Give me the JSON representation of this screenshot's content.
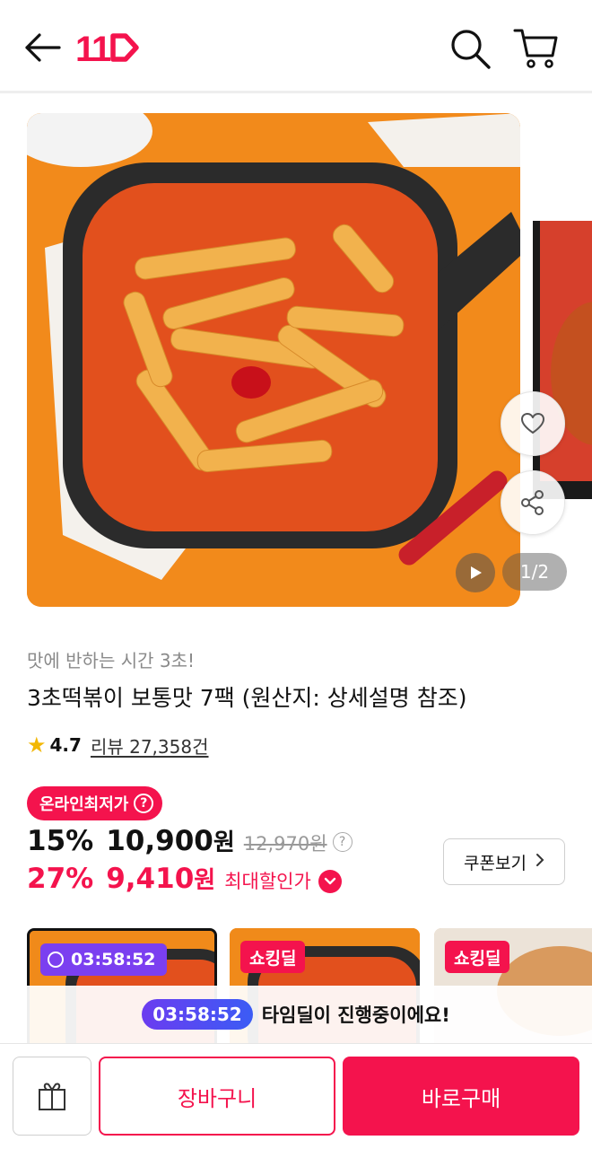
{
  "header": {
    "back_icon": "arrow-left-icon",
    "logo_text": "11",
    "search_icon": "search-icon",
    "cart_icon": "cart-icon",
    "brand_color": "#f4134d"
  },
  "gallery": {
    "page_indicator": "1/2",
    "like_icon": "heart-icon",
    "share_icon": "share-icon",
    "video_icon": "play-icon"
  },
  "product": {
    "subtitle": "맛에 반하는 시간 3초!",
    "title": "3초떡볶이 보통맛 7팩 (원산지: 상세설명 참조)",
    "rating": "4.7",
    "review_label": "리뷰 27,358건"
  },
  "price": {
    "lowest_badge": "온라인최저가",
    "help_mark": "?",
    "discount": "15%",
    "value": "10,900",
    "currency": "원",
    "original": "12,970원",
    "max_discount": "27%",
    "max_value": "9,410",
    "max_label": "최대할인가",
    "coupon_button": "쿠폰보기"
  },
  "deals": [
    {
      "badge": "03:58:52",
      "type": "timer",
      "selected": true
    },
    {
      "badge": "쇼킹딜",
      "type": "shocking",
      "selected": false
    },
    {
      "badge": "쇼킹딜",
      "type": "shocking",
      "selected": false
    }
  ],
  "timedeal_bar": {
    "timer": "03:58:52",
    "message": "타임딜이 진행중이에요!"
  },
  "bottom": {
    "gift_icon": "gift-icon",
    "cart_button": "장바구니",
    "buy_button": "바로구매"
  }
}
